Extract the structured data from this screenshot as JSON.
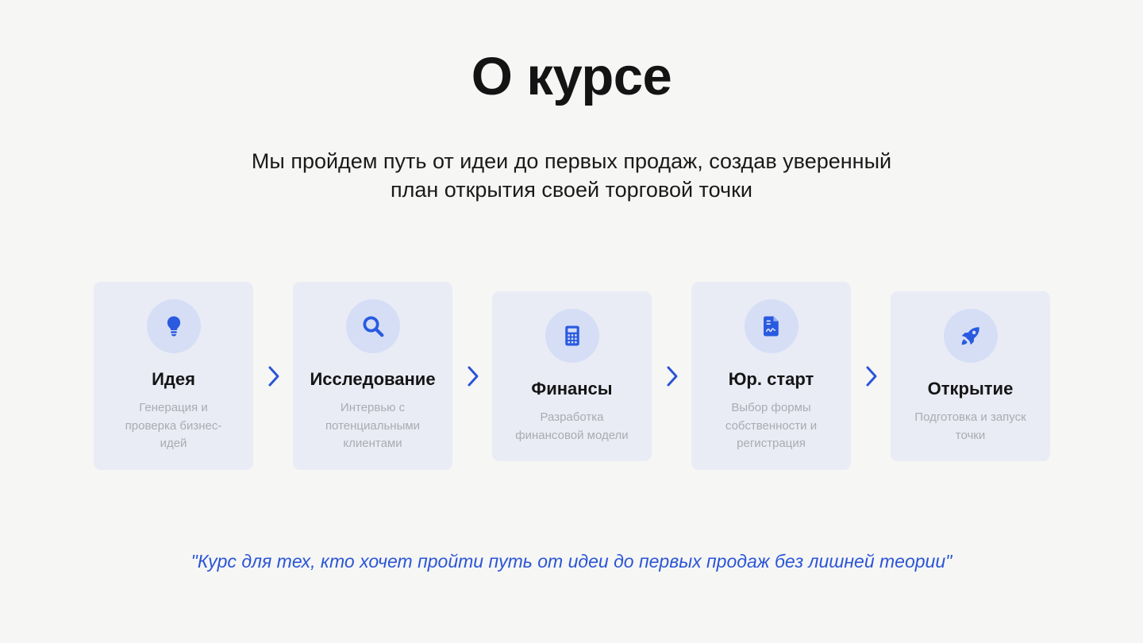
{
  "title": "О курсе",
  "subtitle_line1": "Мы пройдем путь от идеи до первых продаж, создав уверенный",
  "subtitle_line2": "план открытия своей торговой точки",
  "steps": [
    {
      "icon": "lightbulb-icon",
      "title": "Идея",
      "description": "Генерация и проверка бизнес-идей"
    },
    {
      "icon": "search-icon",
      "title": "Исследование",
      "description": "Интервью с потенциальными клиентами"
    },
    {
      "icon": "calculator-icon",
      "title": "Финансы",
      "description": "Разработка финансовой модели"
    },
    {
      "icon": "document-signature-icon",
      "title": "Юр. старт",
      "description": "Выбор формы собственности и регистрация"
    },
    {
      "icon": "rocket-icon",
      "title": "Открытие",
      "description": "Подготовка и запуск точки"
    }
  ],
  "quote": "\"Курс для тех, кто хочет пройти путь от идеи до первых продаж без лишней теории\"",
  "colors": {
    "accent": "#2a55d6",
    "card_bg": "#e9ecf5",
    "icon_circle": "#d6def6",
    "background": "#f6f6f5"
  }
}
